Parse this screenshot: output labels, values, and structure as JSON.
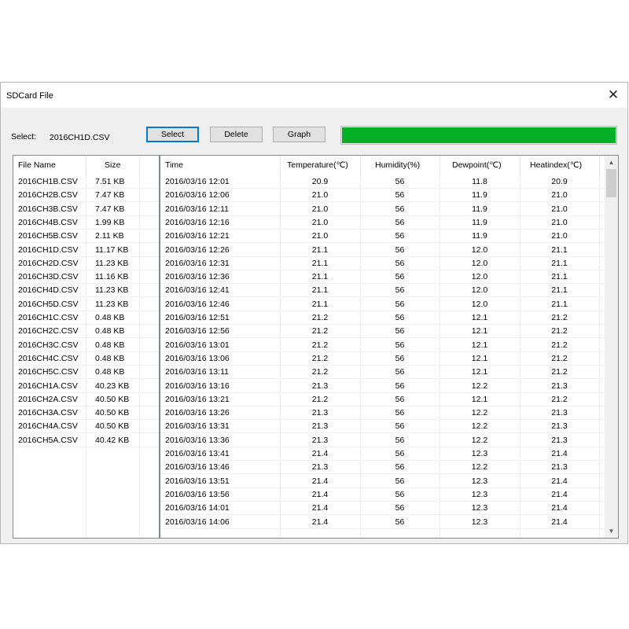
{
  "window": {
    "title": "SDCard File",
    "close_icon": "close-icon"
  },
  "select_label": "Select:",
  "selected_file": "2016CH1D.CSV",
  "buttons": {
    "select": "Select",
    "delete": "Delete",
    "graph": "Graph"
  },
  "progress": {
    "value": 1.0,
    "color": "#06b025"
  },
  "file_list": {
    "columns": [
      "File Name",
      "Size"
    ],
    "rows": [
      [
        "2016CH1B.CSV",
        "7.51 KB"
      ],
      [
        "2016CH2B.CSV",
        "7.47 KB"
      ],
      [
        "2016CH3B.CSV",
        "7.47 KB"
      ],
      [
        "2016CH4B.CSV",
        "1.99 KB"
      ],
      [
        "2016CH5B.CSV",
        "2.11 KB"
      ],
      [
        "2016CH1D.CSV",
        "11.17 KB"
      ],
      [
        "2016CH2D.CSV",
        "11.23 KB"
      ],
      [
        "2016CH3D.CSV",
        "11.16 KB"
      ],
      [
        "2016CH4D.CSV",
        "11.23 KB"
      ],
      [
        "2016CH5D.CSV",
        "11.23 KB"
      ],
      [
        "2016CH1C.CSV",
        "0.48 KB"
      ],
      [
        "2016CH2C.CSV",
        "0.48 KB"
      ],
      [
        "2016CH3C.CSV",
        "0.48 KB"
      ],
      [
        "2016CH4C.CSV",
        "0.48 KB"
      ],
      [
        "2016CH5C.CSV",
        "0.48 KB"
      ],
      [
        "2016CH1A.CSV",
        "40.23 KB"
      ],
      [
        "2016CH2A.CSV",
        "40.50 KB"
      ],
      [
        "2016CH3A.CSV",
        "40.50 KB"
      ],
      [
        "2016CH4A.CSV",
        "40.50 KB"
      ],
      [
        "2016CH5A.CSV",
        "40.42 KB"
      ]
    ]
  },
  "data_table": {
    "columns": [
      "Time",
      "Temperature(℃)",
      "Humidity(%)",
      "Dewpoint(℃)",
      "Heatindex(℃)"
    ],
    "rows": [
      [
        "2016/03/16 12:01",
        "20.9",
        "56",
        "11.8",
        "20.9"
      ],
      [
        "2016/03/16 12:06",
        "21.0",
        "56",
        "11.9",
        "21.0"
      ],
      [
        "2016/03/16 12:11",
        "21.0",
        "56",
        "11.9",
        "21.0"
      ],
      [
        "2016/03/16 12:16",
        "21.0",
        "56",
        "11.9",
        "21.0"
      ],
      [
        "2016/03/16 12:21",
        "21.0",
        "56",
        "11.9",
        "21.0"
      ],
      [
        "2016/03/16 12:26",
        "21.1",
        "56",
        "12.0",
        "21.1"
      ],
      [
        "2016/03/16 12:31",
        "21.1",
        "56",
        "12.0",
        "21.1"
      ],
      [
        "2016/03/16 12:36",
        "21.1",
        "56",
        "12.0",
        "21.1"
      ],
      [
        "2016/03/16 12:41",
        "21.1",
        "56",
        "12.0",
        "21.1"
      ],
      [
        "2016/03/16 12:46",
        "21.1",
        "56",
        "12.0",
        "21.1"
      ],
      [
        "2016/03/16 12:51",
        "21.2",
        "56",
        "12.1",
        "21.2"
      ],
      [
        "2016/03/16 12:56",
        "21.2",
        "56",
        "12.1",
        "21.2"
      ],
      [
        "2016/03/16 13:01",
        "21.2",
        "56",
        "12.1",
        "21.2"
      ],
      [
        "2016/03/16 13:06",
        "21.2",
        "56",
        "12.1",
        "21.2"
      ],
      [
        "2016/03/16 13:11",
        "21.2",
        "56",
        "12.1",
        "21.2"
      ],
      [
        "2016/03/16 13:16",
        "21.3",
        "56",
        "12.2",
        "21.3"
      ],
      [
        "2016/03/16 13:21",
        "21.2",
        "56",
        "12.1",
        "21.2"
      ],
      [
        "2016/03/16 13:26",
        "21.3",
        "56",
        "12.2",
        "21.3"
      ],
      [
        "2016/03/16 13:31",
        "21.3",
        "56",
        "12.2",
        "21.3"
      ],
      [
        "2016/03/16 13:36",
        "21.3",
        "56",
        "12.2",
        "21.3"
      ],
      [
        "2016/03/16 13:41",
        "21.4",
        "56",
        "12.3",
        "21.4"
      ],
      [
        "2016/03/16 13:46",
        "21.3",
        "56",
        "12.2",
        "21.3"
      ],
      [
        "2016/03/16 13:51",
        "21.4",
        "56",
        "12.3",
        "21.4"
      ],
      [
        "2016/03/16 13:56",
        "21.4",
        "56",
        "12.3",
        "21.4"
      ],
      [
        "2016/03/16 14:01",
        "21.4",
        "56",
        "12.3",
        "21.4"
      ],
      [
        "2016/03/16 14:06",
        "21.4",
        "56",
        "12.3",
        "21.4"
      ]
    ]
  }
}
